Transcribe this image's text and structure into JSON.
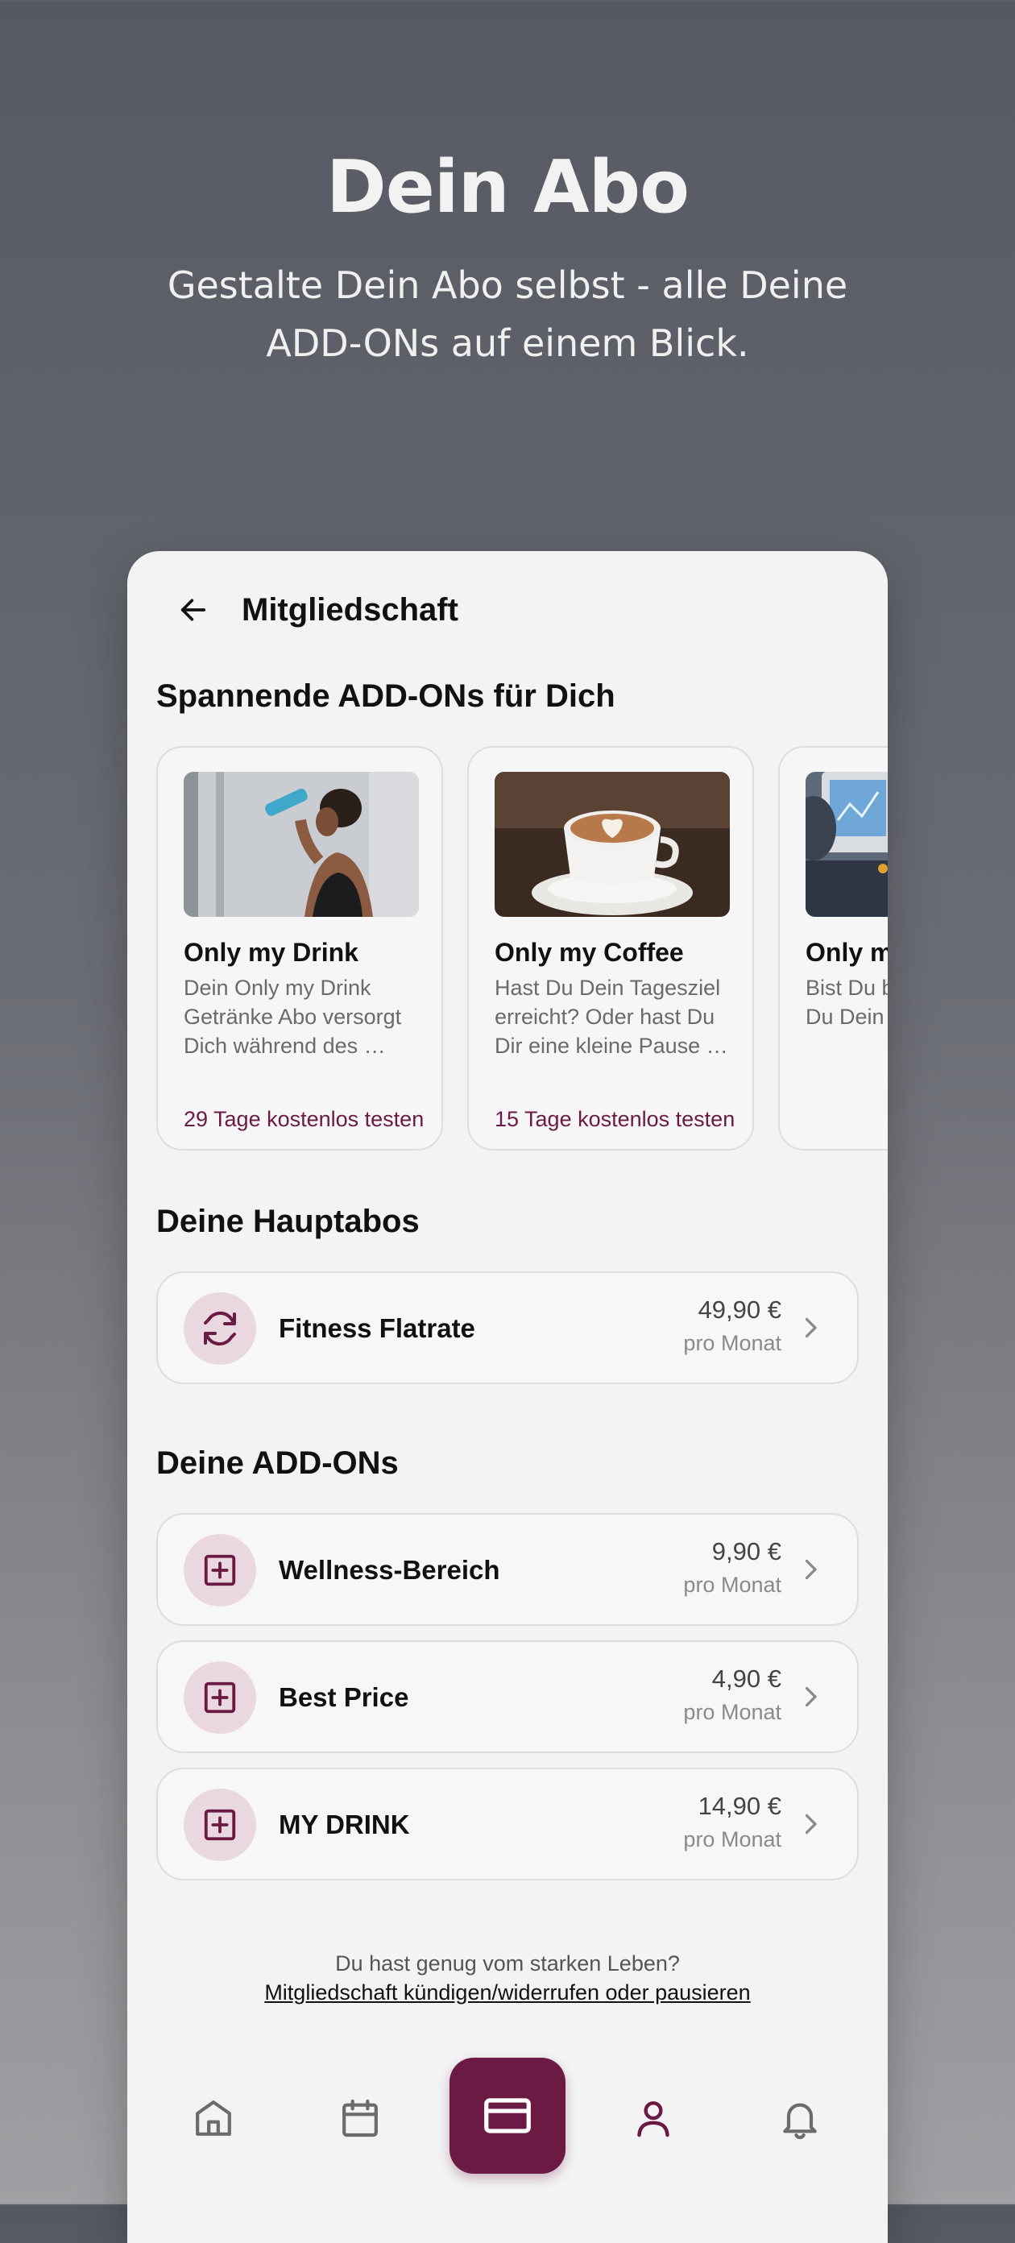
{
  "hero": {
    "title": "Dein Abo",
    "subtitle": "Gestalte Dein Abo selbst - alle Deine ADD-ONs auf einem Blick."
  },
  "header": {
    "title": "Mitgliedschaft"
  },
  "addons_section": {
    "title": "Spannende ADD-ONs für Dich",
    "cards": [
      {
        "name": "Only my Drink",
        "description": "Dein Only my Drink Getränke Abo versorgt Dich während des …",
        "trial": "29 Tage kostenlos testen"
      },
      {
        "name": "Only my Coffee",
        "description": "Hast Du Dein Tagesziel erreicht? Oder hast Du Dir eine kleine Pause …",
        "trial": "15 Tage kostenlos testen"
      },
      {
        "name": "Only my Training",
        "description": "Bist Du bereit? Möchtest Du Dein Training …",
        "trial": ""
      }
    ]
  },
  "main_plans": {
    "title": "Deine Hauptabos",
    "items": [
      {
        "name": "Fitness Flatrate",
        "price": "49,90 €",
        "period": "pro Monat",
        "icon": "refresh-icon"
      }
    ]
  },
  "my_addons": {
    "title": "Deine ADD-ONs",
    "items": [
      {
        "name": "Wellness-Bereich",
        "price": "9,90 €",
        "period": "pro Monat",
        "icon": "plus-square-icon"
      },
      {
        "name": "Best Price",
        "price": "4,90 €",
        "period": "pro Monat",
        "icon": "plus-square-icon"
      },
      {
        "name": "MY DRINK",
        "price": "14,90 €",
        "period": "pro Monat",
        "icon": "plus-square-icon"
      }
    ]
  },
  "footer": {
    "question": "Du hast genug vom starken Leben?",
    "link": "Mitgliedschaft kündigen/widerrufen oder pausieren"
  },
  "nav": {
    "items": [
      "home-icon",
      "calendar-icon",
      "card-icon",
      "user-icon",
      "bell-icon"
    ],
    "active": "card-icon"
  },
  "colors": {
    "accent": "#6b1a44",
    "icon_bg": "#ead8e1"
  }
}
